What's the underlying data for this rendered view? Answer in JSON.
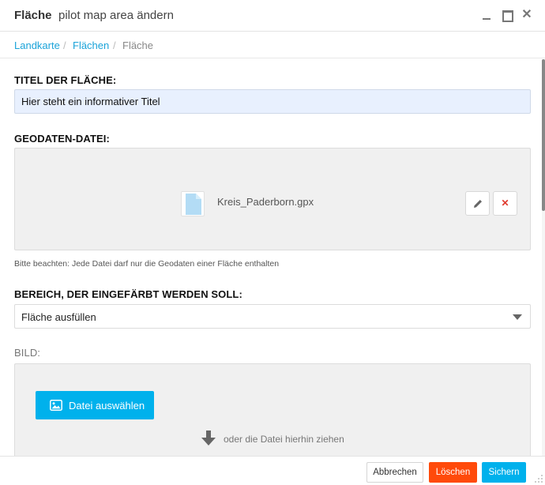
{
  "window": {
    "title_bold": "Fläche",
    "title_sub": "pilot map area ändern",
    "controls": {
      "minimize_icon": "minimize-icon",
      "maximize_icon": "maximize-icon",
      "close_icon": "close-icon",
      "close_glyph": "✕"
    }
  },
  "breadcrumb": {
    "items": [
      {
        "label": "Landkarte"
      },
      {
        "label": "Flächen"
      },
      {
        "label": "Fläche"
      }
    ],
    "separator": "/"
  },
  "form": {
    "title_label": "TITEL DER FLÄCHE:",
    "title_value": "Hier steht ein informativer Titel",
    "geo_label": "GEODATEN-DATEI:",
    "geo_file_name": "Kreis_Paderborn.gpx",
    "geo_remove_glyph": "✕",
    "geo_hint": "Bitte beachten: Jede Datei darf nur die Geodaten einer Fläche enthalten",
    "fill_label": "BEREICH, DER EINGEFÄRBT WERDEN SOLL:",
    "fill_selected": "Fläche ausfüllen",
    "image_label": "BILD:",
    "choose_file_label": "Datei auswählen",
    "drop_hint": "oder die Datei hierhin ziehen"
  },
  "footer": {
    "cancel_label": "Abbrechen",
    "delete_label": "Löschen",
    "save_label": "Sichern"
  },
  "colors": {
    "accent": "#00b1ec",
    "link": "#1aa3d9",
    "danger": "#ff4a0a",
    "input_bg": "#e8f0fe"
  }
}
